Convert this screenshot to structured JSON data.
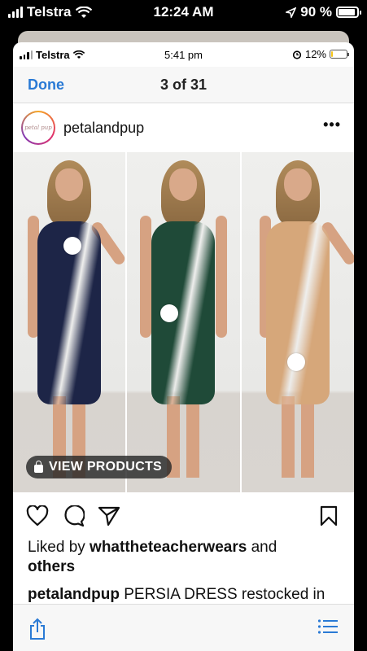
{
  "outer_status": {
    "carrier": "Telstra",
    "time": "12:24 AM",
    "battery": "90 %",
    "battery_level": 0.9
  },
  "inner_status": {
    "carrier": "Telstra",
    "time": "5:41 pm",
    "battery": "12%",
    "battery_level": 0.12
  },
  "nav": {
    "done_label": "Done",
    "counter": "3 of 31"
  },
  "post": {
    "username": "petalandpup",
    "avatar_text": "petal pup",
    "more_label": "•••",
    "view_products_label": "VIEW PRODUCTS",
    "dress_colors": [
      "#1d2547",
      "#1f4a38",
      "#d6a77a"
    ],
    "likes_prefix": "Liked by ",
    "likes_user": "whattheteacherwears",
    "likes_middle": " and",
    "likes_others": "others",
    "caption_user": "petalandpup",
    "caption_text": " PERSIA DRESS restocked in"
  },
  "icons": [
    "heart-icon",
    "comment-icon",
    "send-icon",
    "bookmark-icon",
    "share-icon",
    "list-icon"
  ]
}
